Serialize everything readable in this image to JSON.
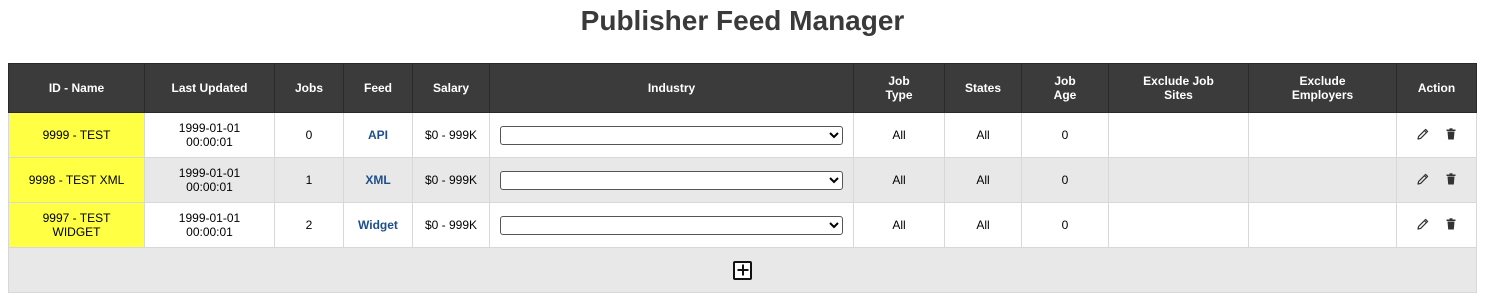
{
  "page": {
    "title": "Publisher Feed Manager"
  },
  "table": {
    "headers": [
      "ID - Name",
      "Last Updated",
      "Jobs",
      "Feed",
      "Salary",
      "Industry",
      "Job Type",
      "States",
      "Job Age",
      "Exclude Job Sites",
      "Exclude Employers",
      "Action"
    ],
    "rows": [
      {
        "id_name": "9999 - TEST",
        "last_updated": "1999-01-01 00:00:01",
        "jobs": "0",
        "feed": "API",
        "salary": "$0 - 999K",
        "industry": "",
        "job_type": "All",
        "states": "All",
        "job_age": "0",
        "exclude_job_sites": "",
        "exclude_employers": ""
      },
      {
        "id_name": "9998 - TEST XML",
        "last_updated": "1999-01-01 00:00:01",
        "jobs": "1",
        "feed": "XML",
        "salary": "$0 - 999K",
        "industry": "",
        "job_type": "All",
        "states": "All",
        "job_age": "0",
        "exclude_job_sites": "",
        "exclude_employers": ""
      },
      {
        "id_name": "9997 - TEST WIDGET",
        "last_updated": "1999-01-01 00:00:01",
        "jobs": "2",
        "feed": "Widget",
        "salary": "$0 - 999K",
        "industry": "",
        "job_type": "All",
        "states": "All",
        "job_age": "0",
        "exclude_job_sites": "",
        "exclude_employers": ""
      }
    ],
    "icons": {
      "edit": "pencil-icon",
      "delete": "trash-icon",
      "add": "plus-icon"
    }
  },
  "colors": {
    "header_bg": "#3b3b3b",
    "id_highlight": "#ffff44",
    "link": "#1f4e8c",
    "alt_row": "#e8e8e8"
  }
}
